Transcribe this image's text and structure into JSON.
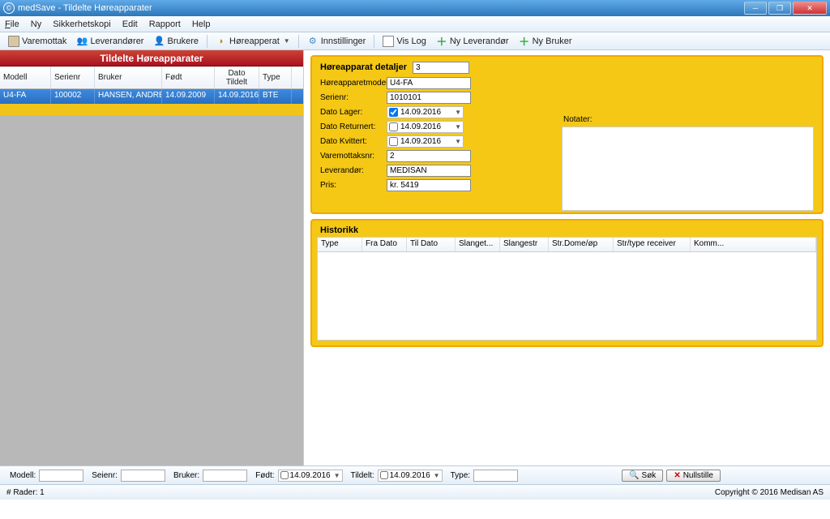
{
  "window": {
    "title": "medSave - Tildelte Høreapparater"
  },
  "menu": {
    "file": "File",
    "ny": "Ny",
    "sikkerhet": "Sikkerhetskopi",
    "edit": "Edit",
    "rapport": "Rapport",
    "help": "Help"
  },
  "toolbar": {
    "varemottak": "Varemottak",
    "leverandorer": "Leverandører",
    "brukere": "Brukere",
    "horeapparat": "Høreapperat",
    "innstillinger": "Innstillinger",
    "vislog": "Vis Log",
    "nylever": "Ny Leverandør",
    "nybruker": "Ny Bruker"
  },
  "left": {
    "title": "Tildelte Høreapparater",
    "cols": {
      "modell": "Modell",
      "serienr": "Serienr",
      "bruker": "Bruker",
      "fodt": "Født",
      "dato": "Dato Tildelt",
      "type": "Type"
    },
    "row": {
      "modell": "U4-FA",
      "serienr": "100002",
      "bruker": "HANSEN, ANDRE",
      "fodt": "14.09.2009",
      "dato": "14.09.2016",
      "type": "BTE"
    }
  },
  "detail": {
    "title": "Høreapparat detaljer",
    "idx": "3",
    "model_lbl": "Høreapparetmodel:",
    "model": "U4-FA",
    "serie_lbl": "Serienr:",
    "serie": "1010101",
    "lager_lbl": "Dato Lager:",
    "lager_date": "14.09.2016",
    "retur_lbl": "Dato Returnert:",
    "retur_date": "14.09.2016",
    "kvitt_lbl": "Dato Kvittert:",
    "kvitt_date": "14.09.2016",
    "vare_lbl": "Varemottaksnr:",
    "vare": "2",
    "lev_lbl": "Leverandør:",
    "lev": "MEDISAN",
    "pris_lbl": "Pris:",
    "pris": "kr. 5419",
    "notater_lbl": "Notater:"
  },
  "hist": {
    "title": "Historikk",
    "cols": {
      "type": "Type",
      "fra": "Fra Dato",
      "til": "Til Dato",
      "slangel": "Slanget...",
      "slangestr": "Slangestr",
      "dome": "Str.Dome/øp",
      "receiver": "Str/type receiver",
      "komm": "Komm..."
    }
  },
  "filter": {
    "modell": "Modell:",
    "serienr": "Seienr:",
    "bruker": "Bruker:",
    "fodt": "Født:",
    "fodt_date": "14.09.2016",
    "tildelt": "Tildelt:",
    "tildelt_date": "14.09.2016",
    "type": "Type:",
    "sok": "Søk",
    "nullstille": "Nullstille"
  },
  "status": {
    "rader": "# Rader: 1",
    "copyright": "Copyright © 2016 Medisan AS"
  }
}
